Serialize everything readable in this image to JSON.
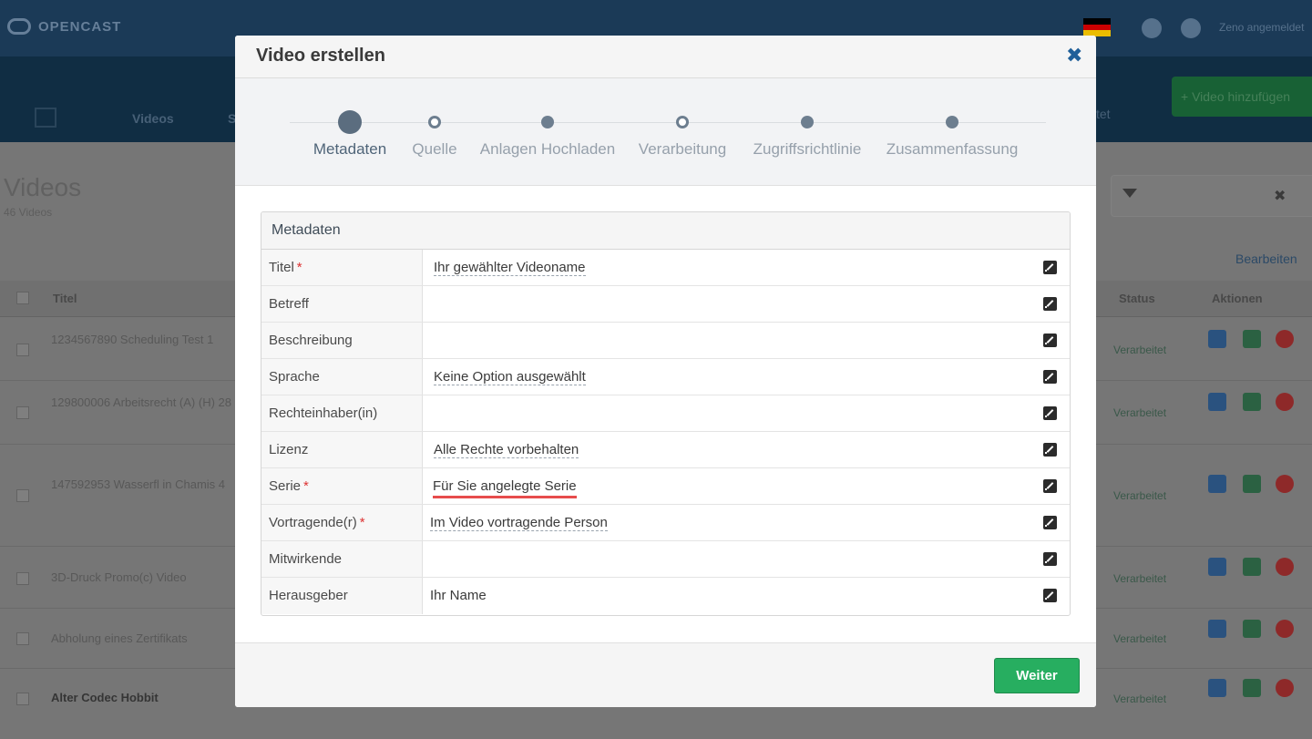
{
  "app": {
    "logo": "OPENCAST",
    "user_label": "Zeno angemeldet",
    "nav_tabs": [
      "Videos",
      "S"
    ],
    "nav_tab_right": "tet",
    "add_video_button": "+ Video hinzufügen",
    "page_title": "Videos",
    "page_subtitle": "46 Videos",
    "edit_link": "Bearbeiten",
    "table_headers": {
      "title": "Titel",
      "status": "Status",
      "actions": "Aktionen"
    },
    "rows": [
      {
        "title": "1234567890 Scheduling Test 1",
        "status": "Verarbeitet"
      },
      {
        "title": "129800006 Arbeitsrecht (A) (H) 28",
        "status": "Verarbeitet"
      },
      {
        "title": "147592953 Wasserfl in Chamis 4",
        "status": "Verarbeitet"
      },
      {
        "title": "3D-Druck Promo(c) Video",
        "status": "Verarbeitet"
      },
      {
        "title": "Abholung eines Zertifikats",
        "status": "Verarbeitet"
      },
      {
        "title": "Alter Codec Hobbit",
        "status": "Verarbeitet"
      }
    ]
  },
  "modal": {
    "title": "Video erstellen",
    "close_symbol": "✖",
    "steps": [
      {
        "label": "Metadaten",
        "state": "active"
      },
      {
        "label": "Quelle",
        "state": "open"
      },
      {
        "label": "Anlagen Hochladen",
        "state": "filled"
      },
      {
        "label": "Verarbeitung",
        "state": "open"
      },
      {
        "label": "Zugriffsrichtlinie",
        "state": "filled"
      },
      {
        "label": "Zusammenfassung",
        "state": "filled"
      }
    ],
    "panel_title": "Metadaten",
    "fields": [
      {
        "label": "Titel",
        "required": true,
        "value": "Ihr gewählter Videoname",
        "style": "dashed"
      },
      {
        "label": "Betreff",
        "required": false,
        "value": "",
        "style": "dashed"
      },
      {
        "label": "Beschreibung",
        "required": false,
        "value": "",
        "style": "dashed"
      },
      {
        "label": "Sprache",
        "required": false,
        "value": "Keine Option ausgewählt",
        "style": "dashed"
      },
      {
        "label": "Rechteinhaber(in)",
        "required": false,
        "value": "",
        "style": "dashed"
      },
      {
        "label": "Lizenz",
        "required": false,
        "value": "Alle Rechte vorbehalten",
        "style": "dashed"
      },
      {
        "label": "Serie",
        "required": true,
        "value": "Für Sie angelegte Serie",
        "style": "highlight"
      },
      {
        "label": "Vortragende(r)",
        "required": true,
        "value": "Im Video vortragende Person",
        "style": "dashed-left"
      },
      {
        "label": "Mitwirkende",
        "required": false,
        "value": "",
        "style": "dashed"
      },
      {
        "label": "Herausgeber",
        "required": false,
        "value": "Ihr Name",
        "style": "plain"
      }
    ],
    "required_marker": "*",
    "next_button": "Weiter"
  },
  "colors": {
    "accent_blue": "#1f5f99",
    "success_green": "#27ae60",
    "required_red": "#d33333",
    "highlight_red": "#e74c4c"
  }
}
